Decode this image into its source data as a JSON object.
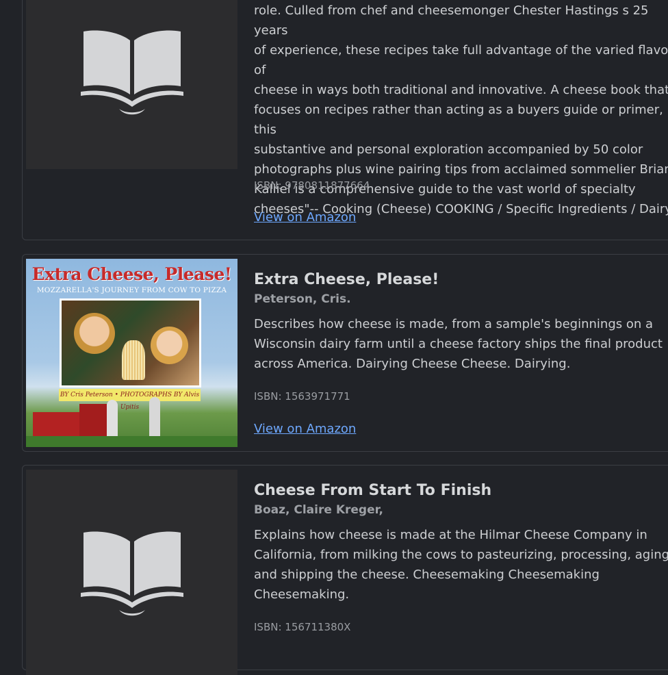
{
  "books": [
    {
      "cover_icon": "book-icon",
      "title": "",
      "author": "",
      "description_lines": [
        "role. Culled from chef and cheesemonger Chester Hastings s 25 years",
        "of experience, these recipes take full advantage of the varied flavors of",
        "cheese in ways both traditional and innovative. A cheese book that",
        "focuses on recipes rather than acting as a buyers guide or primer, this",
        "substantive and personal exploration accompanied by 50 color",
        "photographs plus wine pairing tips from acclaimed sommelier Brian",
        "Kalliel is a comprehensive guide to the vast world of specialty",
        "cheeses\"-- Cooking (Cheese) COOKING / Specific Ingredients / Dairy."
      ],
      "isbn": "ISBN: 9780811877664",
      "link": "View on Amazon"
    },
    {
      "cover_art": {
        "title": "Extra Cheese, Please!",
        "subtitle": "MOZZARELLA'S JOURNEY FROM COW TO PIZZA",
        "credit": "BY Cris Peterson • PHOTOGRAPHS BY Alvis Upitis"
      },
      "title": "Extra Cheese, Please!",
      "author": "Peterson, Cris.",
      "description_lines": [
        "Describes how cheese is made, from a sample's beginnings on a",
        "Wisconsin dairy farm until a cheese factory ships the final product",
        "across America. Dairying Cheese Cheese. Dairying."
      ],
      "isbn": "ISBN: 1563971771",
      "link": "View on Amazon"
    },
    {
      "cover_icon": "book-icon",
      "title": "Cheese From Start To Finish",
      "author": "Boaz, Claire Kreger,",
      "description_lines": [
        "Explains how cheese is made at the Hilmar Cheese Company in",
        "California, from milking the cows to pasteurizing, processing, aging,",
        "and shipping the cheese. Cheesemaking Cheesemaking",
        "Cheesemaking."
      ],
      "isbn": "ISBN: 156711380X",
      "link": "View on Amazon"
    }
  ],
  "colors": {
    "background": "#212328",
    "card_border": "#3b3e44",
    "cover_placeholder": "#2c2c2e",
    "link": "#6ea8fe"
  }
}
